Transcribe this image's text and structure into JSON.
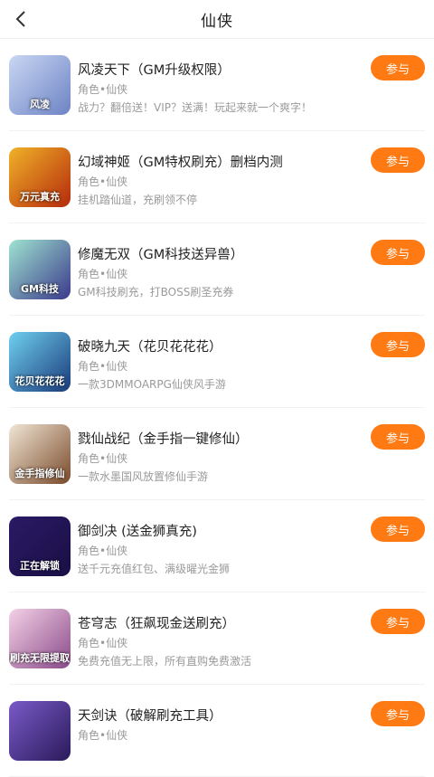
{
  "header": {
    "title": "仙侠",
    "back_icon": "chevron-left-icon"
  },
  "join_label": "参与",
  "games": [
    {
      "name": "风凌天下（GM升级权限）",
      "category": "角色•仙侠",
      "desc": "战力？翻倍送！VIP？送满！玩起来就一个爽字！",
      "icon_text": "风凌",
      "colors": [
        "#c9d7f3",
        "#6d83c4"
      ]
    },
    {
      "name": "幻域神姬（GM特权刷充）删档内测",
      "category": "角色•仙侠",
      "desc": "挂机踏仙道，充刷领不停",
      "icon_text": "万元真充",
      "colors": [
        "#f0b228",
        "#b52a0c"
      ]
    },
    {
      "name": "修魔无双（GM科技送异兽）",
      "category": "角色•仙侠",
      "desc": "GM科技刷充，打BOSS刷圣充券",
      "icon_text": "GM科技",
      "colors": [
        "#9fe3d0",
        "#3b3a8c"
      ]
    },
    {
      "name": "破晓九天（花贝花花花）",
      "category": "角色•仙侠",
      "desc": "一款3DMMOARPG仙侠风手游",
      "icon_text": "花贝花花花",
      "colors": [
        "#6fd0f0",
        "#1a3a7a"
      ]
    },
    {
      "name": "戮仙战纪（金手指一键修仙）",
      "category": "角色•仙侠",
      "desc": "一款水墨国风放置修仙手游",
      "icon_text": "金手指修仙",
      "colors": [
        "#f1e6d6",
        "#7a4a2a"
      ]
    },
    {
      "name": "御剑决 (送金狮真充)",
      "category": "角色•仙侠",
      "desc": "送千元充值红包、满级曜光金狮",
      "icon_text": "正在解锁",
      "colors": [
        "#2a1a66",
        "#1a0f44"
      ]
    },
    {
      "name": "苍穹志（狂飙现金送刷充）",
      "category": "角色•仙侠",
      "desc": "免费充值无上限，所有直购免费激活",
      "icon_text": "刷充无限提取",
      "colors": [
        "#f4d1e6",
        "#8a4a8a"
      ]
    },
    {
      "name": "天剑诀（破解刷充工具）",
      "category": "角色•仙侠",
      "desc": "",
      "icon_text": "",
      "colors": [
        "#7a5ac8",
        "#2a1a5a"
      ]
    }
  ]
}
